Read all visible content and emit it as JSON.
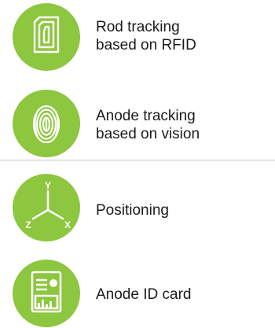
{
  "colors": {
    "accent": "#8dc63f",
    "icon": "#ffffff",
    "text": "#1b1b1b",
    "divider": "#c8c8c8"
  },
  "features": [
    {
      "icon": "rfid-tag-icon",
      "line1": "Rod tracking",
      "line2": "based on RFID"
    },
    {
      "icon": "fingerprint-icon",
      "line1": "Anode tracking",
      "line2": "based on vision"
    },
    {
      "icon": "xyz-axes-icon",
      "line1": "Positioning",
      "axis_y": "Y",
      "axis_z": "Z",
      "axis_x": "X"
    },
    {
      "icon": "id-card-icon",
      "line1": "Anode ID card"
    }
  ]
}
